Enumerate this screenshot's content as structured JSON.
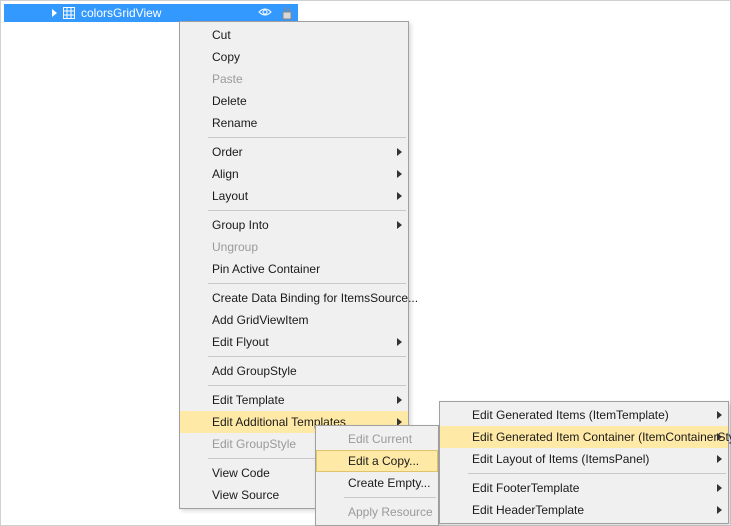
{
  "tree": {
    "selectedItem": "colorsGridView"
  },
  "contextMenu": {
    "cut": "Cut",
    "copy": "Copy",
    "paste": "Paste",
    "delete": "Delete",
    "rename": "Rename",
    "order": "Order",
    "align": "Align",
    "layout": "Layout",
    "groupInto": "Group Into",
    "ungroup": "Ungroup",
    "pinActiveContainer": "Pin Active Container",
    "createDataBinding": "Create Data Binding for ItemsSource...",
    "addGridViewItem": "Add GridViewItem",
    "editFlyout": "Edit Flyout",
    "addGroupStyle": "Add GroupStyle",
    "editTemplate": "Edit Template",
    "editAdditionalTemplates": "Edit Additional Templates",
    "editGroupStyle": "Edit GroupStyle",
    "viewCode": "View Code",
    "viewSource": "View Source"
  },
  "submenu1": {
    "editCurrent": "Edit Current",
    "editACopy": "Edit a Copy...",
    "createEmpty": "Create Empty...",
    "applyResource": "Apply Resource"
  },
  "submenu2": {
    "editGeneratedItems": "Edit Generated Items (ItemTemplate)",
    "editGeneratedItemContainer": "Edit Generated Item Container (ItemContainerStyle)",
    "editLayoutOfItems": "Edit Layout of Items (ItemsPanel)",
    "editFooterTemplate": "Edit FooterTemplate",
    "editHeaderTemplate": "Edit HeaderTemplate"
  }
}
